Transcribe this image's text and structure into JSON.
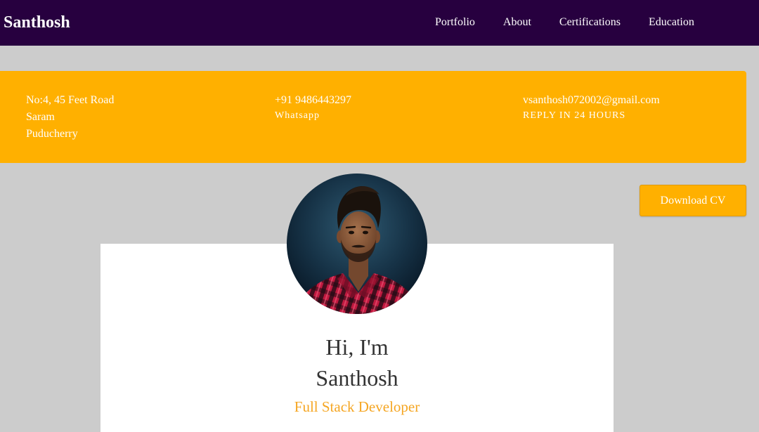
{
  "navbar": {
    "brand": "Santhosh",
    "links": [
      {
        "label": "Portfolio"
      },
      {
        "label": "About"
      },
      {
        "label": "Certifications"
      },
      {
        "label": "Education"
      }
    ]
  },
  "contact": {
    "address_lines": [
      "No:4, 45 Feet Road",
      "Saram",
      "Puducherry"
    ],
    "phone": "+91 9486443297",
    "phone_note": "Whatsapp",
    "email": "vsanthosh072002@gmail.com",
    "email_note": "REPLY IN 24 HOURS"
  },
  "actions": {
    "download_cv": "Download CV"
  },
  "profile": {
    "greeting": "Hi, I'm",
    "name": "Santhosh",
    "role": "Full Stack Developer"
  },
  "theme": {
    "nav_background": "#27003f",
    "page_background": "#cccccc",
    "accent": "#ffb000",
    "card_background": "#ffffff",
    "heading_text": "#333333",
    "role_text": "#f5a623"
  }
}
